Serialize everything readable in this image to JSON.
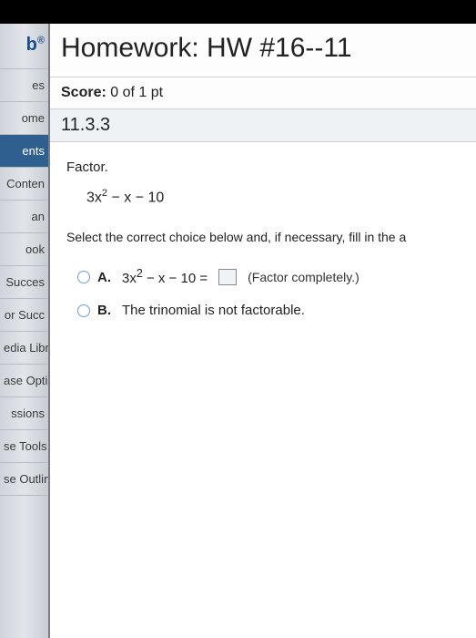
{
  "sidebar": {
    "logo_text": "b",
    "items": [
      {
        "label": "es"
      },
      {
        "label": "ome"
      },
      {
        "label": "ents",
        "active": true
      },
      {
        "label": "Conten"
      },
      {
        "label": "an"
      },
      {
        "label": "ook"
      },
      {
        "label": "Succes"
      },
      {
        "label": "or Succ"
      },
      {
        "label": "edia Libr"
      },
      {
        "label": "ase Optio"
      },
      {
        "label": "ssions"
      },
      {
        "label": "se Tools"
      },
      {
        "label": "se Outline"
      }
    ]
  },
  "header": {
    "hw_title": "Homework: HW #16--11",
    "score_label": "Score:",
    "score_value": "0 of 1 pt",
    "question_number": "11.3.3"
  },
  "question": {
    "instruction": "Factor.",
    "expression_a": "3x",
    "expression_exp": "2",
    "expression_b": " − x − 10",
    "select_prompt": "Select the correct choice below and, if necessary, fill in the a",
    "choices": {
      "A": {
        "letter": "A.",
        "expr_a": "3x",
        "expr_exp": "2",
        "expr_b": " − x − 10 = ",
        "hint": "(Factor completely.)"
      },
      "B": {
        "letter": "B.",
        "text": "The trinomial is not factorable."
      }
    }
  }
}
